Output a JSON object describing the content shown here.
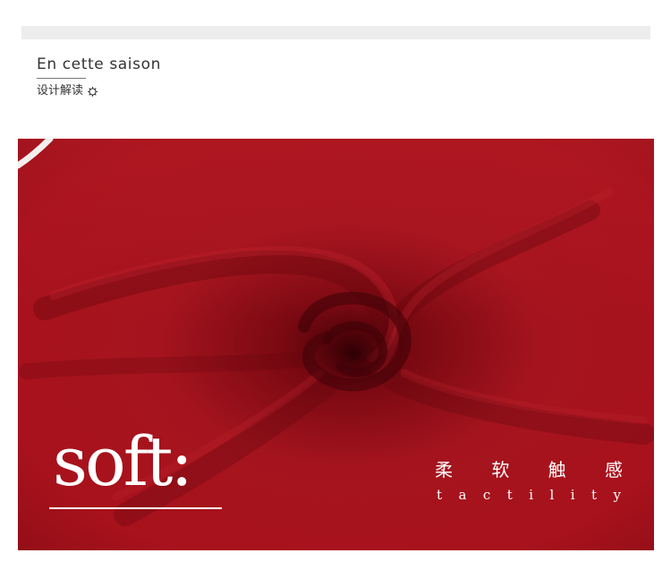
{
  "header": {
    "title": "En cette saison",
    "subtitle": "设计解读",
    "subtitle_icon": "gear-icon"
  },
  "feature": {
    "main_word": "soft:",
    "chinese_chars": [
      "柔",
      "软",
      "触",
      "感"
    ],
    "english_letters": [
      "t",
      "a",
      "c",
      "t",
      "i",
      "l",
      "i",
      "t",
      "y"
    ]
  },
  "colors": {
    "fabric_red": "#a1111b",
    "text_dark": "#333333",
    "bar_gray": "#ededed"
  }
}
